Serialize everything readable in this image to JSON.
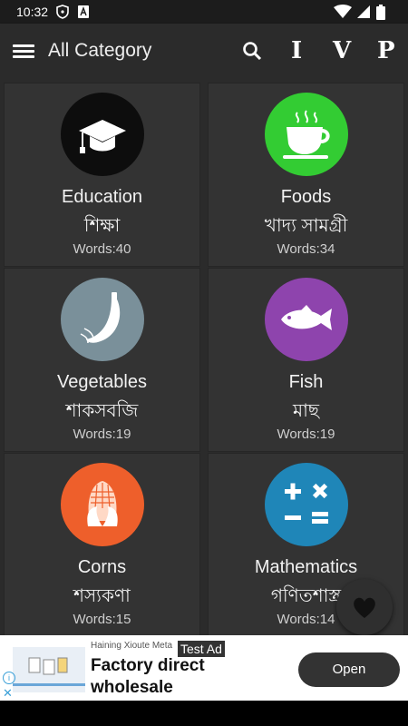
{
  "status_bar": {
    "time": "10:32",
    "icons": [
      "shield-icon",
      "a-box-icon",
      "wifi-icon",
      "signal-icon",
      "battery-icon"
    ]
  },
  "app_bar": {
    "title": "All Category",
    "menu_icon": "menu-icon",
    "search_icon": "search-icon",
    "letters": [
      "I",
      "V",
      "P"
    ]
  },
  "categories": [
    {
      "en": "Education",
      "bn": "শিক্ষা",
      "words": "Words:40",
      "icon": "graduation-cap-icon",
      "color": "#0d0d0d"
    },
    {
      "en": "Foods",
      "bn": "খাদ্য সামগ্রী",
      "words": "Words:34",
      "icon": "tea-cup-icon",
      "color": "#33cc33"
    },
    {
      "en": "Vegetables",
      "bn": "শাকসবজি",
      "words": "Words:19",
      "icon": "banana-icon",
      "color": "#7a909a"
    },
    {
      "en": "Fish",
      "bn": "মাছ",
      "words": "Words:19",
      "icon": "fish-icon",
      "color": "#8e44ad"
    },
    {
      "en": "Corns",
      "bn": "শস্যকণা",
      "words": "Words:15",
      "icon": "corn-icon",
      "color": "#ee5f2b"
    },
    {
      "en": "Mathematics",
      "bn": "গণিতশাস্ত্র",
      "words": "Words:14",
      "icon": "math-operators-icon",
      "color": "#1f86b8"
    }
  ],
  "fab": {
    "icon": "heart-icon"
  },
  "ad": {
    "advertiser": "Haining Xioute Meta",
    "badge": "Test Ad",
    "headline": "Factory direct wholesale",
    "button": "Open"
  }
}
